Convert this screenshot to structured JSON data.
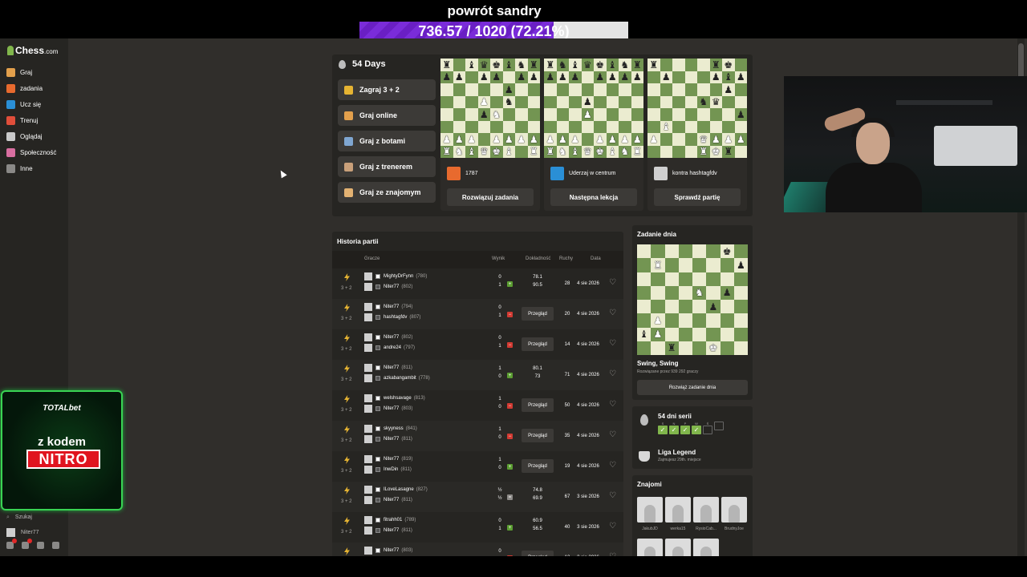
{
  "overlay": {
    "title": "powrót sandry",
    "progress_text": "736.57 / 1020 (72.21%)",
    "progress_fraction": 0.7221
  },
  "sidebar": {
    "logo": "Chess",
    "logo_suffix": ".com",
    "items": [
      {
        "label": "Graj",
        "icon": "pawn-icon",
        "color": "#e3a04c"
      },
      {
        "label": "zadania",
        "icon": "puzzle-icon",
        "color": "#e86a2e"
      },
      {
        "label": "Ucz się",
        "icon": "graduation-cap-icon",
        "color": "#2a8fd6"
      },
      {
        "label": "Trenuj",
        "icon": "target-icon",
        "color": "#e04e3a"
      },
      {
        "label": "Oglądaj",
        "icon": "binoculars-icon",
        "color": "#c9c9c9"
      },
      {
        "label": "Społeczność",
        "icon": "community-icon",
        "color": "#d86ea0"
      },
      {
        "label": "Inne",
        "icon": "more-icon",
        "color": "#8a8987"
      }
    ],
    "search": "Szukaj",
    "user": "Niter77",
    "badges": {
      "notifications": "2"
    }
  },
  "top": {
    "streak_days": "54 Days",
    "play_buttons": [
      {
        "label": "Zagraj 3 + 2",
        "icon": "lightning-icon",
        "color": "#e6b432"
      },
      {
        "label": "Graj online",
        "icon": "pawn-icon",
        "color": "#e3a04c"
      },
      {
        "label": "Graj z botami",
        "icon": "bot-icon",
        "color": "#7fa6d1"
      },
      {
        "label": "Graj z trenerem",
        "icon": "coach-icon",
        "color": "#c9a07a"
      },
      {
        "label": "Graj ze znajomym",
        "icon": "handshake-icon",
        "color": "#e3b272"
      }
    ],
    "cards": [
      {
        "info": "1787",
        "button": "Rozwiązuj zadania",
        "icon": "puzzle-icon",
        "color": "#e86a2e"
      },
      {
        "info": "Uderzaj w centrum",
        "button": "Następna lekcja",
        "icon": "graduation-cap-icon",
        "color": "#2a8fd6"
      },
      {
        "info": "kontra hashtagfdv",
        "button": "Sprawdź partię",
        "icon": "avatar-icon",
        "color": "#cfcfcf"
      }
    ]
  },
  "boards": [
    [
      "bR",
      "",
      "bB",
      "bQ",
      "bK",
      "bB",
      "bN",
      "bR",
      "bP",
      "bP",
      "",
      "bP",
      "bP",
      "",
      "bP",
      "bP",
      "",
      "",
      "",
      "",
      "",
      "bP",
      "",
      "",
      "",
      "",
      "",
      "wP",
      "",
      "bN",
      "",
      "",
      "",
      "",
      "",
      "bP",
      "wN",
      "",
      "",
      "",
      "",
      "",
      "",
      "",
      "",
      "",
      "",
      "",
      "wP",
      "wP",
      "wP",
      "",
      "wP",
      "wP",
      "wP",
      "wP",
      "wR",
      "wN",
      "wB",
      "wQ",
      "wK",
      "wB",
      "",
      "wR"
    ],
    [
      "bR",
      "bN",
      "bB",
      "bQ",
      "bK",
      "bB",
      "bN",
      "bR",
      "bP",
      "bP",
      "bP",
      "",
      "bP",
      "bP",
      "bP",
      "bP",
      "",
      "",
      "",
      "",
      "",
      "",
      "",
      "",
      "",
      "",
      "",
      "bP",
      "",
      "",
      "",
      "",
      "",
      "",
      "",
      "wP",
      "",
      "",
      "",
      "",
      "",
      "",
      "",
      "",
      "",
      "",
      "",
      "",
      "wP",
      "wP",
      "wP",
      "",
      "wP",
      "wP",
      "wP",
      "wP",
      "wR",
      "wN",
      "wB",
      "wQ",
      "wK",
      "wB",
      "wN",
      "wR"
    ],
    [
      "bR",
      "",
      "",
      "",
      "",
      "bR",
      "bK",
      "",
      "",
      "bP",
      "",
      "",
      "",
      "bP",
      "bB",
      "bP",
      "",
      "",
      "",
      "",
      "",
      "",
      "bP",
      "",
      "",
      "",
      "",
      "",
      "bN",
      "bQ",
      "",
      "",
      "",
      "",
      "",
      "",
      "",
      "",
      "",
      "bP",
      "",
      "wB",
      "",
      "",
      "",
      "",
      "",
      "",
      "wP",
      "",
      "",
      "",
      "wQ",
      "wP",
      "wP",
      "wP",
      "",
      "",
      "",
      "",
      "wR",
      "wK",
      "bR",
      ""
    ]
  ],
  "history": {
    "title": "Historia partii",
    "columns": {
      "players": "Gracze",
      "result": "Wynik",
      "accuracy": "Dokładność",
      "moves": "Ruchy",
      "date": "Data"
    },
    "review_label": "Przegląd",
    "rows": [
      {
        "tc": "3 + 2",
        "white": "MightyDrFynn",
        "white_rating": "(780)",
        "black": "Niter77",
        "black_rating": "(802)",
        "r1": "0",
        "r2": "1",
        "outcome": "win",
        "acc1": "78.1",
        "acc2": "90.5",
        "moves": "28",
        "date": "4 sie 2026"
      },
      {
        "tc": "3 + 2",
        "white": "Niter77",
        "white_rating": "(794)",
        "black": "hashtagfdv",
        "black_rating": "(807)",
        "r1": "0",
        "r2": "1",
        "outcome": "loss",
        "acc1": "",
        "acc2": "",
        "moves": "20",
        "date": "4 sie 2026"
      },
      {
        "tc": "3 + 2",
        "white": "Niter77",
        "white_rating": "(802)",
        "black": "andre24",
        "black_rating": "(797)",
        "r1": "0",
        "r2": "1",
        "outcome": "loss",
        "acc1": "",
        "acc2": "",
        "moves": "14",
        "date": "4 sie 2026"
      },
      {
        "tc": "3 + 2",
        "white": "Niter77",
        "white_rating": "(811)",
        "black": "azkabangambit",
        "black_rating": "(778)",
        "r1": "1",
        "r2": "0",
        "outcome": "win",
        "acc1": "80.1",
        "acc2": "73",
        "moves": "71",
        "date": "4 sie 2026"
      },
      {
        "tc": "3 + 2",
        "white": "welshsavage",
        "white_rating": "(813)",
        "black": "Niter77",
        "black_rating": "(803)",
        "r1": "1",
        "r2": "0",
        "outcome": "loss",
        "acc1": "",
        "acc2": "",
        "moves": "50",
        "date": "4 sie 2026"
      },
      {
        "tc": "3 + 2",
        "white": "skyyness",
        "white_rating": "(841)",
        "black": "Niter77",
        "black_rating": "(811)",
        "r1": "1",
        "r2": "0",
        "outcome": "loss",
        "acc1": "",
        "acc2": "",
        "moves": "35",
        "date": "4 sie 2026"
      },
      {
        "tc": "3 + 2",
        "white": "Niter77",
        "white_rating": "(819)",
        "black": "InwDin",
        "black_rating": "(811)",
        "r1": "1",
        "r2": "0",
        "outcome": "win",
        "acc1": "",
        "acc2": "",
        "moves": "19",
        "date": "4 sie 2026"
      },
      {
        "tc": "3 + 2",
        "white": "ILoveLasagne",
        "white_rating": "(827)",
        "black": "Niter77",
        "black_rating": "(811)",
        "r1": "½",
        "r2": "½",
        "outcome": "draw",
        "acc1": "74.8",
        "acc2": "69.9",
        "moves": "67",
        "date": "3 sie 2026"
      },
      {
        "tc": "3 + 2",
        "white": "fitrahh01",
        "white_rating": "(789)",
        "black": "Niter77",
        "black_rating": "(811)",
        "r1": "0",
        "r2": "1",
        "outcome": "win",
        "acc1": "60.9",
        "acc2": "56.5",
        "moves": "40",
        "date": "3 sie 2026"
      },
      {
        "tc": "3 + 2",
        "white": "Niter77",
        "white_rating": "(803)",
        "black": "",
        "black_rating": "",
        "r1": "0",
        "r2": "",
        "outcome": "loss",
        "acc1": "",
        "acc2": "",
        "moves": "12",
        "date": "3 sie 2026"
      }
    ]
  },
  "daily": {
    "title": "Zadanie dnia",
    "board": [
      "",
      "",
      "",
      "",
      "",
      "",
      "bK",
      "",
      "",
      "wR",
      "",
      "",
      "",
      "",
      "",
      "bP",
      "",
      "",
      "",
      "",
      "",
      "",
      "",
      "",
      "",
      "",
      "",
      "",
      "wN",
      "",
      "bP",
      "",
      "",
      "",
      "",
      "",
      "",
      "bP",
      "",
      "",
      "",
      "wP",
      "",
      "",
      "",
      "",
      "",
      "",
      "bB",
      "wP",
      "",
      "",
      "",
      "",
      "",
      "",
      "",
      "",
      "bR",
      "",
      "",
      "wK",
      "",
      ""
    ],
    "name": "Swing, Swing",
    "solved": "Rozwiązane przez 939 292 graczy",
    "button": "Rozwiąż zadanie dnia"
  },
  "streak": {
    "title": "54 dni serii",
    "days": [
      "S",
      "N",
      "P",
      "W",
      "Ś"
    ],
    "done": [
      true,
      true,
      true,
      true,
      false
    ],
    "league_title": "Liga Legend",
    "league_sub": "Zajmujesz 29th. miejsce"
  },
  "friends": {
    "title": "Znajomi",
    "list": [
      "JakubJD",
      "werka15",
      "RysioCab...",
      "BrudnyJoe",
      "",
      "",
      ""
    ]
  },
  "ad": {
    "brand": "TOTALbet",
    "line1": "z kodem",
    "code": "NITRO"
  }
}
